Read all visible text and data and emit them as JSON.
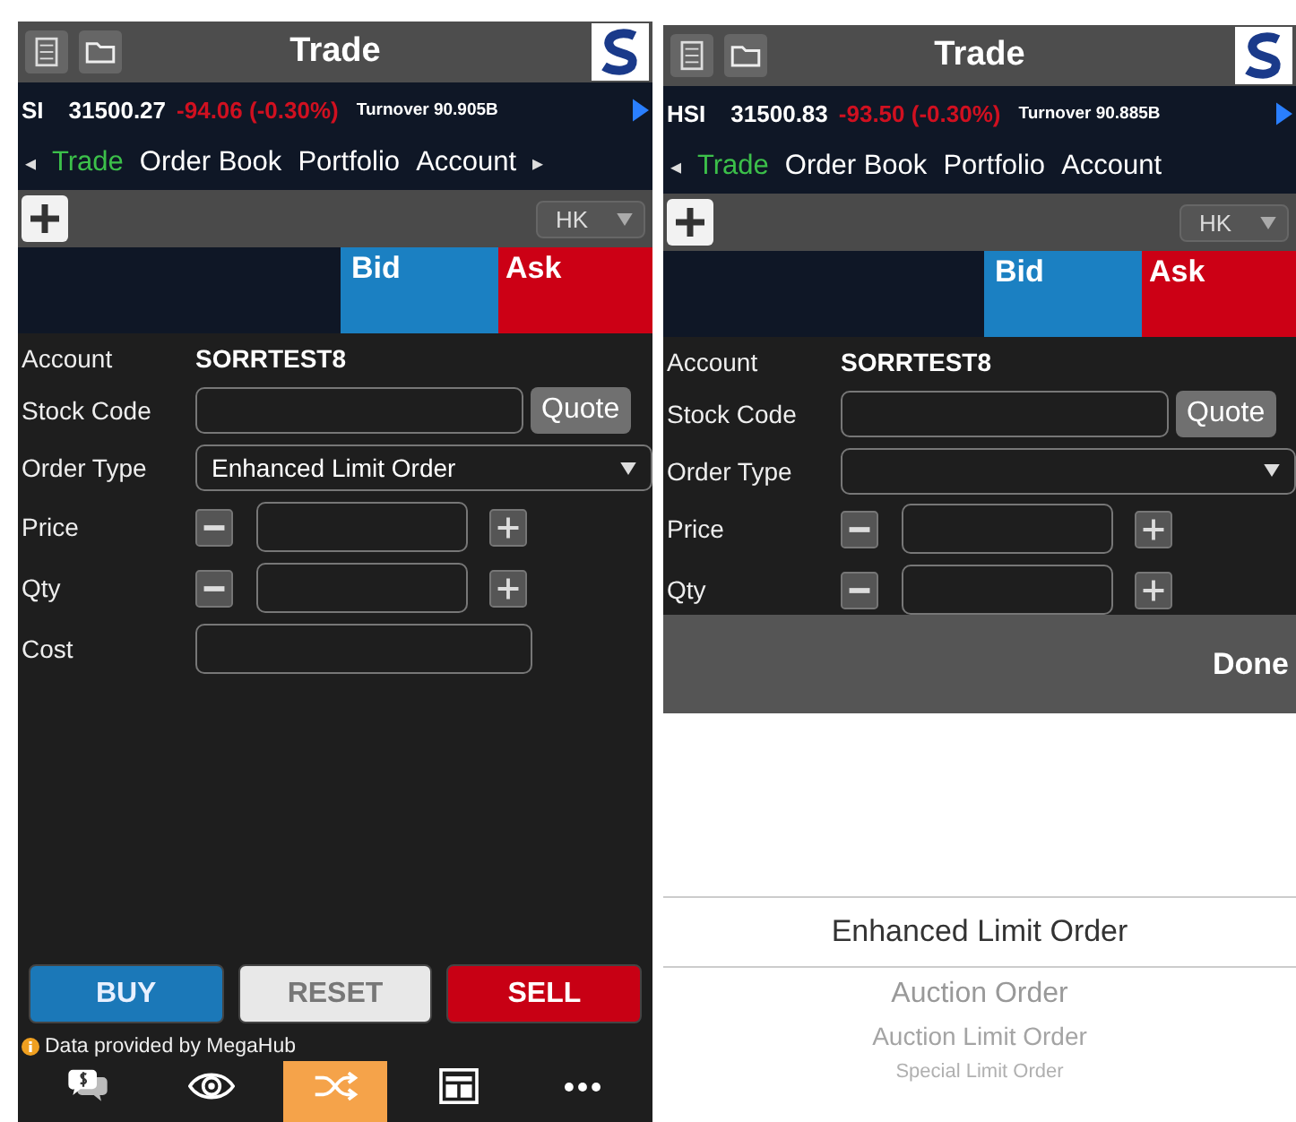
{
  "screens": [
    {
      "title": "Trade",
      "ticker": {
        "index": "SI",
        "value": "31500.27",
        "change": "-94.06 (-0.30%)",
        "turnover": "Turnover 90.905B"
      },
      "nav": {
        "prev": "◂",
        "next": "▸",
        "tabs": [
          {
            "label": "Trade",
            "selected": true
          },
          {
            "label": "Order Book",
            "selected": false
          },
          {
            "label": "Portfolio",
            "selected": false
          },
          {
            "label": "Account",
            "selected": false
          }
        ]
      },
      "market": "HK",
      "bid": "Bid",
      "ask": "Ask",
      "form": [
        {
          "kind": "text",
          "label": "Account",
          "value": "SORRTEST8"
        },
        {
          "kind": "quote",
          "label": "Stock Code",
          "button": "Quote"
        },
        {
          "kind": "select",
          "label": "Order Type",
          "value": "Enhanced Limit Order"
        },
        {
          "kind": "stepper",
          "label": "Price"
        },
        {
          "kind": "stepper",
          "label": "Qty"
        },
        {
          "kind": "field",
          "label": "Cost"
        }
      ],
      "actions": [
        {
          "label": "BUY",
          "kind": "buy"
        },
        {
          "label": "RESET",
          "kind": "reset"
        },
        {
          "label": "SELL",
          "kind": "sell"
        }
      ],
      "info": "Data provided by MegaHub",
      "tab_bar": [
        {
          "selected": false
        },
        {
          "selected": false
        },
        {
          "selected": true
        },
        {
          "selected": false
        },
        {
          "selected": false
        }
      ]
    },
    {
      "title": "Trade",
      "ticker": {
        "index": "HSI",
        "value": "31500.83",
        "change": "-93.50 (-0.30%)",
        "turnover": "Turnover 90.885B"
      },
      "nav": {
        "prev": "◂",
        "tabs": [
          {
            "label": "Trade",
            "selected": true
          },
          {
            "label": "Order Book",
            "selected": false
          },
          {
            "label": "Portfolio",
            "selected": false
          },
          {
            "label": "Account",
            "selected": false
          }
        ]
      },
      "market": "HK",
      "bid": "Bid",
      "ask": "Ask",
      "form": [
        {
          "kind": "text",
          "label": "Account",
          "value": "SORRTEST8"
        },
        {
          "kind": "quote",
          "label": "Stock Code",
          "button": "Quote"
        },
        {
          "kind": "select",
          "label": "Order Type"
        },
        {
          "kind": "stepper",
          "label": "Price"
        },
        {
          "kind": "stepper",
          "label": "Qty"
        }
      ],
      "picker": {
        "done": "Done",
        "items": [
          {
            "label": "Enhanced Limit Order",
            "selected": true
          },
          {
            "label": "Auction Order",
            "selected": false
          },
          {
            "label": "Auction Limit Order",
            "selected": false
          },
          {
            "label": "Special Limit Order",
            "selected": false
          }
        ]
      }
    }
  ]
}
